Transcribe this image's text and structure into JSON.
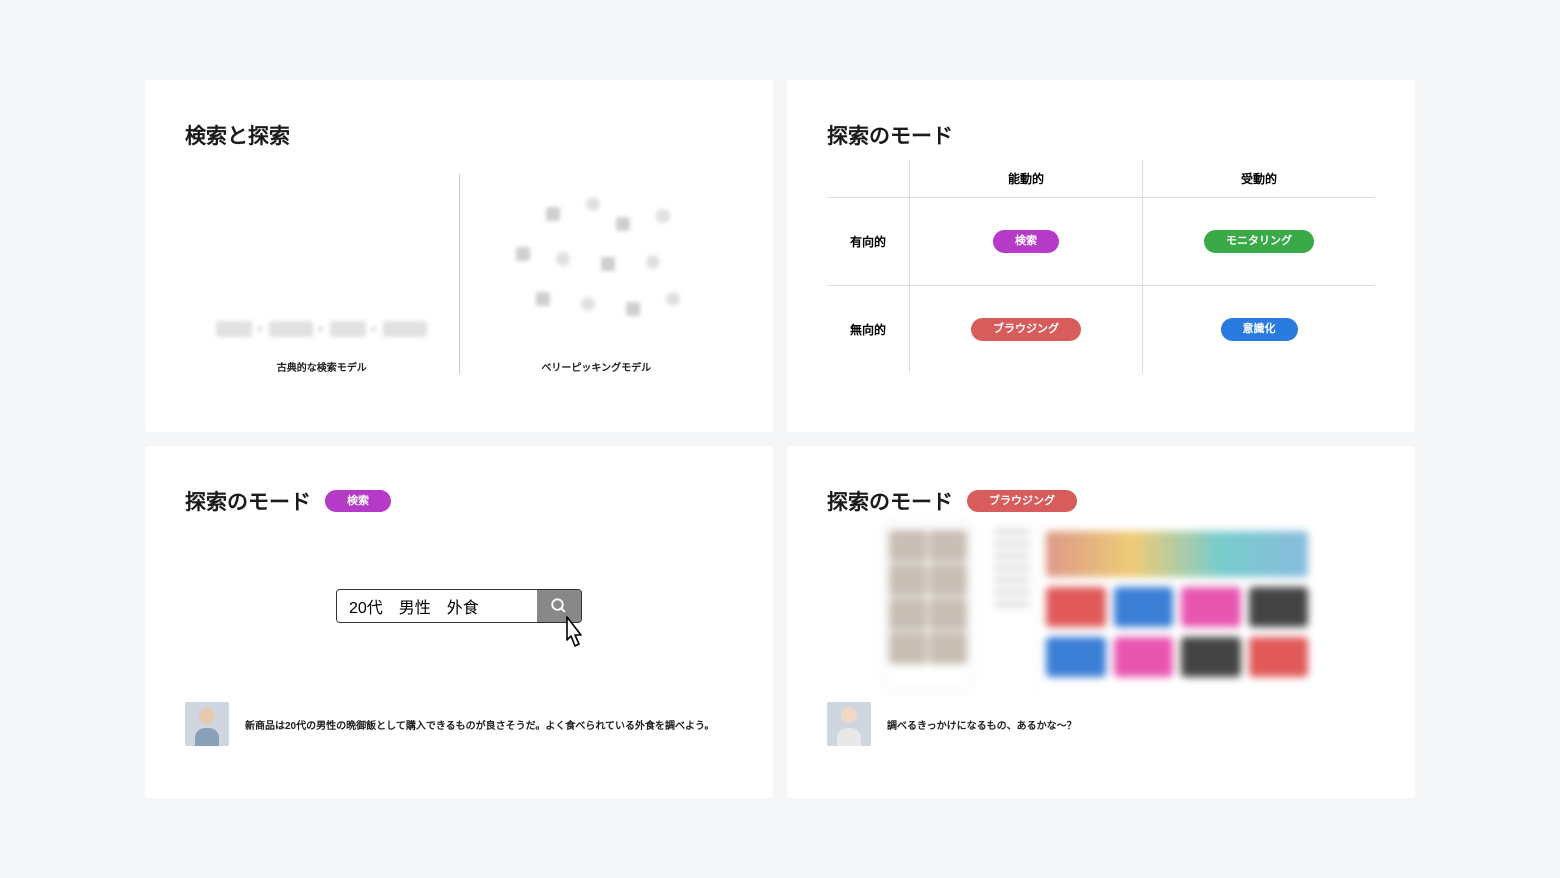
{
  "slide1": {
    "title": "検索と探索",
    "model_a": "古典的な検索モデル",
    "model_b": "ベリーピッキングモデル"
  },
  "slide2": {
    "title": "探索のモード",
    "col_a": "能動的",
    "col_b": "受動的",
    "row_a": "有向的",
    "row_b": "無向的",
    "cell_aa": "検索",
    "cell_ab": "モニタリング",
    "cell_ba": "ブラウジング",
    "cell_bb": "意識化",
    "colors": {
      "aa": "#b43ac7",
      "ab": "#3aa947",
      "ba": "#d95c5c",
      "bb": "#2a7be0"
    }
  },
  "slide3": {
    "title": "探索のモード",
    "pill": "検索",
    "search_value": "20代　男性　外食",
    "persona_text": "新商品は20代の男性の晩御飯として購入できるものが良さそうだ。よく食べられている外食を調べよう。"
  },
  "slide4": {
    "title": "探索のモード",
    "pill": "ブラウジング",
    "persona_text": "調べるきっかけになるもの、あるかな〜？"
  }
}
